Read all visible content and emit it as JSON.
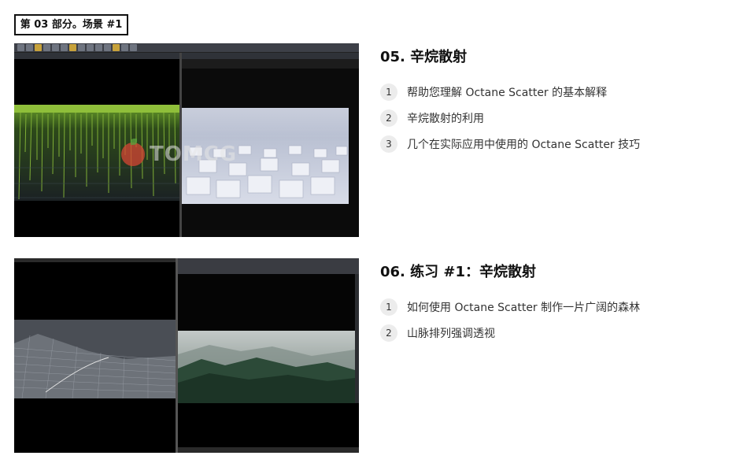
{
  "section": {
    "label": "第 03 部分。场景 #1"
  },
  "lessons": [
    {
      "title": "05. 辛烷散射",
      "watermark": "TOMCG",
      "items": [
        {
          "num": "1",
          "text": "帮助您理解 Octane Scatter 的基本解释"
        },
        {
          "num": "2",
          "text": "辛烷散射的利用"
        },
        {
          "num": "3",
          "text": "几个在实际应用中使用的 Octane Scatter 技巧"
        }
      ]
    },
    {
      "title": "06. 练习 #1：辛烷散射",
      "items": [
        {
          "num": "1",
          "text": "如何使用 Octane Scatter 制作一片广阔的森林"
        },
        {
          "num": "2",
          "text": "山脉排列强调透视"
        }
      ]
    }
  ],
  "colors": {
    "grass": "#8fbf3a",
    "cube_light": "#e6e9f2",
    "forest_dark": "#1f3a2c",
    "fog": "#c9cfcf",
    "wireframe": "#9aa0a8",
    "watermark_red": "#d64634"
  }
}
